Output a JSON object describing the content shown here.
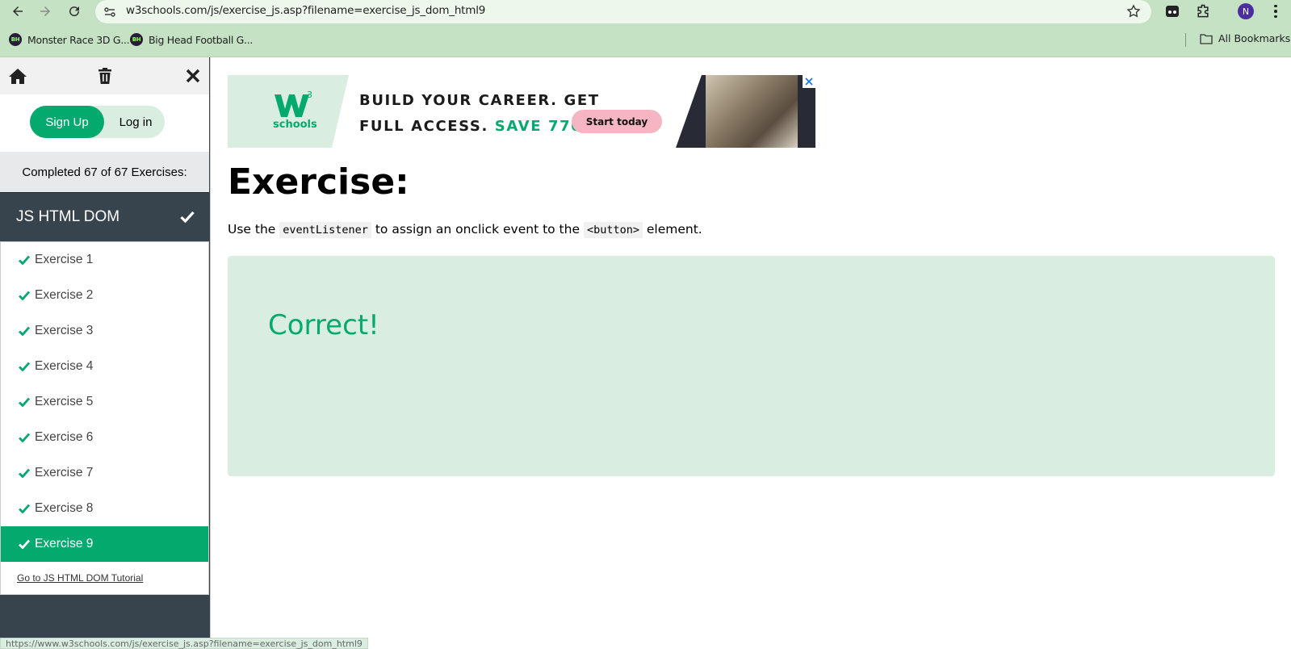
{
  "browser": {
    "url": "w3schools.com/js/exercise_js.asp?filename=exercise_js_dom_html9",
    "profile_initial": "N",
    "bookmarks": [
      {
        "label": "Monster Race 3D G..."
      },
      {
        "label": "Big Head Football G..."
      }
    ],
    "all_bookmarks_label": "All Bookmarks",
    "status_url": "https://www.w3schools.com/js/exercise_js.asp?filename=exercise_js_dom_html9"
  },
  "sidebar": {
    "signup_label": "Sign Up",
    "login_label": "Log in",
    "completed_text": "Completed 67 of 67 Exercises:",
    "section_title": "JS HTML DOM",
    "items": [
      {
        "label": "Exercise 1"
      },
      {
        "label": "Exercise 2"
      },
      {
        "label": "Exercise 3"
      },
      {
        "label": "Exercise 4"
      },
      {
        "label": "Exercise 5"
      },
      {
        "label": "Exercise 6"
      },
      {
        "label": "Exercise 7"
      },
      {
        "label": "Exercise 8"
      },
      {
        "label": "Exercise 9"
      }
    ],
    "active_index": 8,
    "tutorial_link": "Go to JS HTML DOM Tutorial"
  },
  "ad": {
    "logo_text": "schools",
    "line1": "BUILD YOUR CAREER. GET",
    "line2_prefix": "FULL ACCESS.",
    "line2_save": "SAVE 770$",
    "cta_label": "Start today"
  },
  "main": {
    "title": "Exercise:",
    "instruction_before": "Use the ",
    "instruction_code1": "eventListener",
    "instruction_middle": " to assign an onclick event to the ",
    "instruction_code2": "<button>",
    "instruction_after": " element.",
    "result_text": "Correct!"
  },
  "colors": {
    "accent": "#04aa6d",
    "sidebar_dark": "#38444d",
    "result_bg": "#d9eee1",
    "browser_bar": "#c6e2c4"
  }
}
